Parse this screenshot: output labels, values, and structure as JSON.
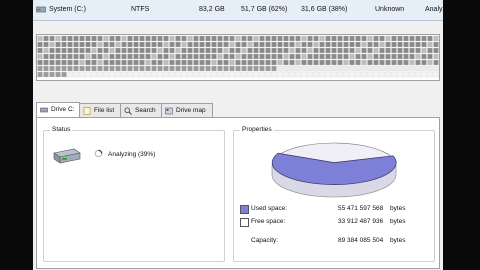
{
  "drive_row": {
    "name": "System (C:)",
    "fs": "NTFS",
    "size": "83,2 GB",
    "used": "51,7 GB (62%)",
    "free": "31,6 GB (38%)",
    "status": "Unknown",
    "state": "Analyzi"
  },
  "tabs": [
    {
      "label": "Drive C:",
      "icon": "drive-icon"
    },
    {
      "label": "File list",
      "icon": "file-list-icon"
    },
    {
      "label": "Search",
      "icon": "search-icon"
    },
    {
      "label": "Drive map",
      "icon": "drive-map-icon"
    }
  ],
  "status": {
    "title": "Status",
    "text": "Analyzing (39%)",
    "progress": 0.39
  },
  "properties": {
    "title": "Properties",
    "used_label": "Used space:",
    "used_value": "55 471 597 568",
    "free_label": "Free space:",
    "free_value": "33 912 487 936",
    "capacity_label": "Capacity:",
    "capacity_value": "89 384 085 504",
    "unit": "bytes",
    "used_fraction": 0.62,
    "colors": {
      "used": "#7e7fd6",
      "free": "#efeff5"
    }
  }
}
